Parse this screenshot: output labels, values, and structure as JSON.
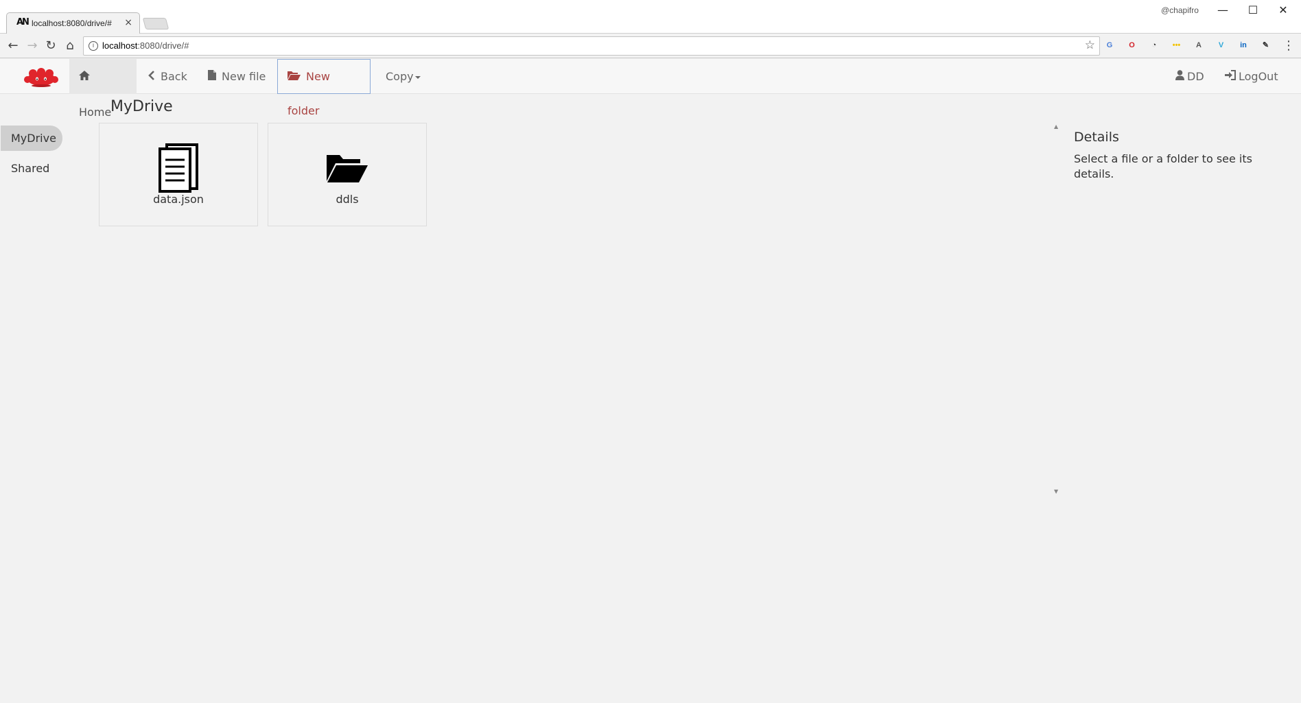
{
  "browser": {
    "tab_title": "localhost:8080/drive/#",
    "tab_favicon": "AN",
    "tab_close": "×",
    "profile_name": "@chapifro",
    "window_controls": {
      "minimize": "—",
      "maximize": "☐",
      "close": "✕"
    },
    "url_host": "localhost",
    "url_path": ":8080/drive/#",
    "nav": {
      "back": "←",
      "forward": "→",
      "reload": "↻",
      "home": "⌂"
    },
    "star": "☆",
    "extensions": [
      {
        "name": "translate-extension-icon",
        "glyph": "G",
        "color": "#4a7fd8"
      },
      {
        "name": "opera-extension-icon",
        "glyph": "O",
        "color": "#d3242b"
      },
      {
        "name": "clock-extension-icon",
        "glyph": "◔",
        "color": "#333333"
      },
      {
        "name": "password-extension-icon",
        "glyph": "•••",
        "color": "#f2c200"
      },
      {
        "name": "angular-extension-icon",
        "glyph": "A",
        "color": "#555555"
      },
      {
        "name": "vuejs-extension-icon",
        "glyph": "V",
        "color": "#30a8d8"
      },
      {
        "name": "linkedin-extension-icon",
        "glyph": "in",
        "color": "#0a66c2"
      },
      {
        "name": "eyedropper-extension-icon",
        "glyph": "✎",
        "color": "#333333"
      }
    ],
    "menu": "⋮"
  },
  "navbar": {
    "home": "Home",
    "back": "Back",
    "new_file": "New file",
    "new_folder": "New folder",
    "copy": "Copy",
    "user": "DD",
    "logout": "LogOut"
  },
  "sidebar": {
    "items": [
      {
        "label": "MyDrive"
      },
      {
        "label": "Shared"
      }
    ]
  },
  "main": {
    "title": "MyDrive",
    "items": [
      {
        "name": "data.json",
        "kind": "file"
      },
      {
        "name": "ddls",
        "kind": "folder"
      }
    ]
  },
  "details": {
    "title": "Details",
    "text": "Select a file or a folder to see its details."
  },
  "colors": {
    "accent_red": "#a94442",
    "logo_red": "#e0252c"
  }
}
